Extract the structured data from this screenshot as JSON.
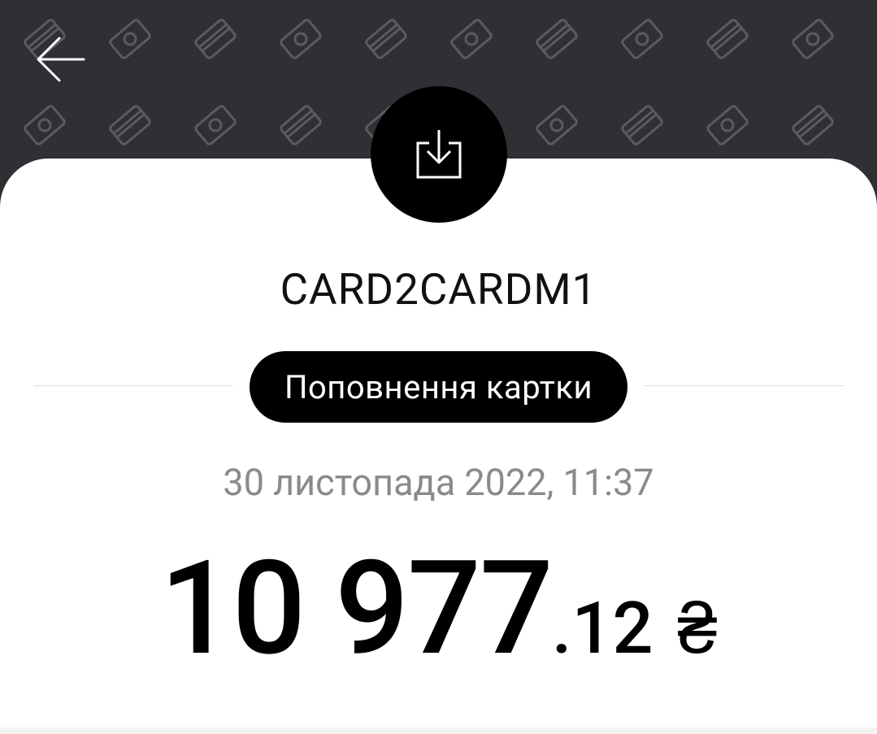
{
  "header": {
    "back_icon": "arrow-left-icon",
    "pattern_icons": [
      "card-icon",
      "money-icon"
    ]
  },
  "transaction": {
    "type_icon": "download-icon",
    "merchant": "CARD2CARDM1",
    "category": "Поповнення картки",
    "datetime": "30 листопада 2022, 11:37",
    "amount_integer": "10 977",
    "amount_fraction": ".12",
    "currency": "₴"
  },
  "colors": {
    "header_bg": "#2f2f34",
    "sheet_bg": "#ffffff",
    "accent": "#000000",
    "muted_text": "#8a8a8a"
  }
}
